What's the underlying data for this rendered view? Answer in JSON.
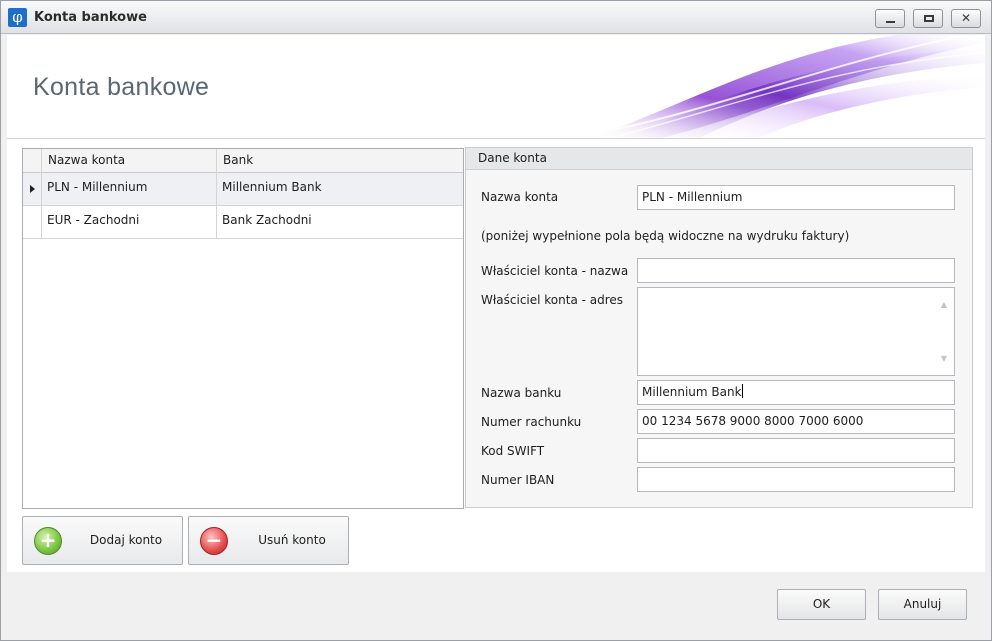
{
  "window": {
    "title": "Konta bankowe"
  },
  "header": {
    "title": "Konta bankowe"
  },
  "grid": {
    "columns": [
      "Nazwa konta",
      "Bank"
    ],
    "rows": [
      {
        "name": "PLN - Millennium",
        "bank": "Millennium Bank",
        "selected": true
      },
      {
        "name": "EUR - Zachodni",
        "bank": "Bank Zachodni",
        "selected": false
      }
    ]
  },
  "actions": {
    "add_label": "Dodaj konto",
    "delete_label": "Usuń konto"
  },
  "details": {
    "group_title": "Dane konta",
    "account_name_label": "Nazwa konta",
    "account_name_value": "PLN - Millennium",
    "note": "(poniżej wypełnione pola będą widoczne na wydruku faktury)",
    "owner_name_label": "Właściciel konta - nazwa",
    "owner_name_value": "",
    "owner_address_label": "Właściciel konta - adres",
    "owner_address_value": "",
    "bank_name_label": "Nazwa banku",
    "bank_name_value": "Millennium Bank",
    "account_number_label": "Numer rachunku",
    "account_number_value": "00 1234 5678 9000 8000 7000 6000",
    "swift_label": "Kod SWIFT",
    "swift_value": "",
    "iban_label": "Numer IBAN",
    "iban_value": ""
  },
  "footer": {
    "ok_label": "OK",
    "cancel_label": "Anuluj"
  },
  "icons": {
    "app": "phi-app-icon",
    "add": "plus-circle-icon",
    "delete": "minus-circle-icon"
  },
  "colors": {
    "accent": "#1f6fc5",
    "swoosh": "#8b3fd1",
    "add": "#79c240",
    "delete": "#e24b4b"
  }
}
